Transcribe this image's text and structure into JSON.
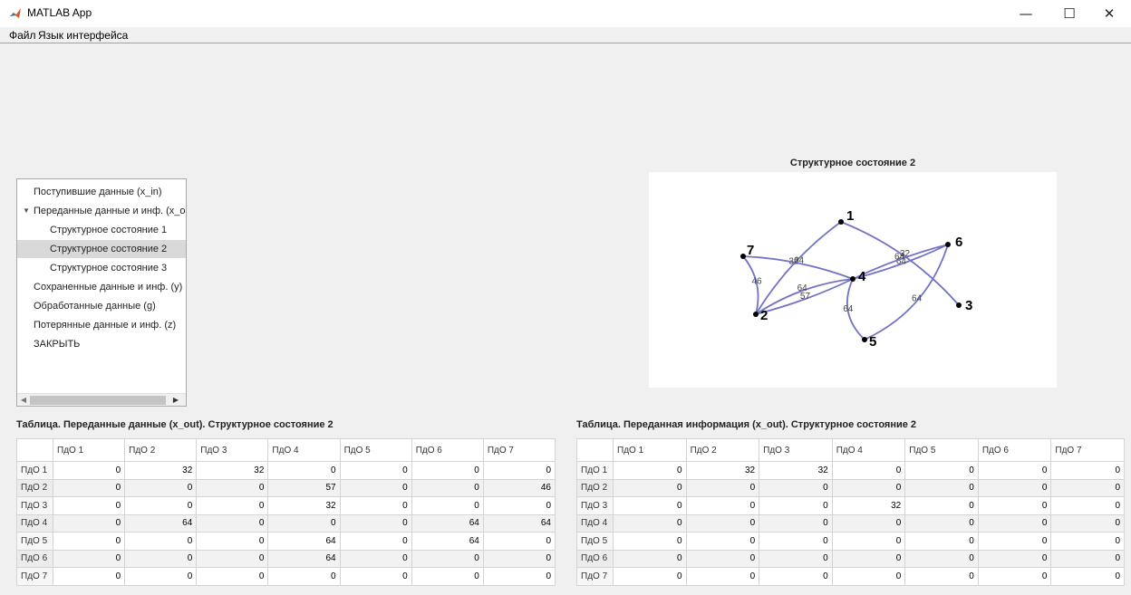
{
  "window": {
    "title": "MATLAB App",
    "min_glyph": "—",
    "max_glyph": "☐",
    "close_glyph": "✕"
  },
  "menu": [
    "Файл",
    "Язык интерфейса"
  ],
  "tree": {
    "items": [
      {
        "label": "Поступившие данные (x_in)",
        "level": 0,
        "expanded": false,
        "selected": false
      },
      {
        "label": "Переданные данные и инф. (x_out)",
        "level": 0,
        "expanded": true,
        "selected": false
      },
      {
        "label": "Структурное состояние 1",
        "level": 1,
        "expanded": false,
        "selected": false
      },
      {
        "label": "Структурное состояние 2",
        "level": 1,
        "expanded": false,
        "selected": true
      },
      {
        "label": "Структурное состояние 3",
        "level": 1,
        "expanded": false,
        "selected": false
      },
      {
        "label": "Сохраненные данные и инф. (y)",
        "level": 0,
        "expanded": false,
        "selected": false
      },
      {
        "label": "Обработанные данные (g)",
        "level": 0,
        "expanded": false,
        "selected": false
      },
      {
        "label": "Потерянные данные и инф. (z)",
        "level": 0,
        "expanded": false,
        "selected": false
      },
      {
        "label": "ЗАКРЫТЬ",
        "level": 0,
        "expanded": false,
        "selected": false
      }
    ]
  },
  "graph": {
    "title": "Структурное состояние 2",
    "edge_color": "#7272c6",
    "nodes": [
      "1",
      "2",
      "3",
      "4",
      "5",
      "6",
      "7"
    ],
    "edges": [
      {
        "from": "1",
        "to": "2",
        "label": "32"
      },
      {
        "from": "1",
        "to": "3",
        "label": "32"
      },
      {
        "from": "2",
        "to": "4",
        "label": "57"
      },
      {
        "from": "2",
        "to": "7",
        "label": "46"
      },
      {
        "from": "4",
        "to": "2",
        "label": "64"
      },
      {
        "from": "4",
        "to": "6",
        "label": "64"
      },
      {
        "from": "4",
        "to": "7",
        "label": "64"
      },
      {
        "from": "5",
        "to": "4",
        "label": "64"
      },
      {
        "from": "5",
        "to": "6",
        "label": "64"
      },
      {
        "from": "6",
        "to": "4",
        "label": "64"
      }
    ]
  },
  "table_left": {
    "caption": "Таблица. Переданные данные (x_out). Структурное состояние 2",
    "columns": [
      "ПдО 1",
      "ПдО 2",
      "ПдО 3",
      "ПдО 4",
      "ПдО 5",
      "ПдО 6",
      "ПдО 7"
    ],
    "rows": [
      {
        "label": "ПдО 1",
        "values": [
          "0",
          "32",
          "32",
          "0",
          "0",
          "0",
          "0"
        ]
      },
      {
        "label": "ПдО 2",
        "values": [
          "0",
          "0",
          "0",
          "57",
          "0",
          "0",
          "46"
        ]
      },
      {
        "label": "ПдО 3",
        "values": [
          "0",
          "0",
          "0",
          "32",
          "0",
          "0",
          "0"
        ]
      },
      {
        "label": "ПдО 4",
        "values": [
          "0",
          "64",
          "0",
          "0",
          "0",
          "64",
          "64"
        ]
      },
      {
        "label": "ПдО 5",
        "values": [
          "0",
          "0",
          "0",
          "64",
          "0",
          "64",
          "0"
        ]
      },
      {
        "label": "ПдО 6",
        "values": [
          "0",
          "0",
          "0",
          "64",
          "0",
          "0",
          "0"
        ]
      },
      {
        "label": "ПдО 7",
        "values": [
          "0",
          "0",
          "0",
          "0",
          "0",
          "0",
          "0"
        ]
      }
    ]
  },
  "table_right": {
    "caption": "Таблица. Переданная информация (x_out). Структурное состояние 2",
    "columns": [
      "ПдО 1",
      "ПдО 2",
      "ПдО 3",
      "ПдО 4",
      "ПдО 5",
      "ПдО 6",
      "ПдО 7"
    ],
    "rows": [
      {
        "label": "ПдО 1",
        "values": [
          "0",
          "32",
          "32",
          "0",
          "0",
          "0",
          "0"
        ]
      },
      {
        "label": "ПдО 2",
        "values": [
          "0",
          "0",
          "0",
          "0",
          "0",
          "0",
          "0"
        ]
      },
      {
        "label": "ПдО 3",
        "values": [
          "0",
          "0",
          "0",
          "32",
          "0",
          "0",
          "0"
        ]
      },
      {
        "label": "ПдО 4",
        "values": [
          "0",
          "0",
          "0",
          "0",
          "0",
          "0",
          "0"
        ]
      },
      {
        "label": "ПдО 5",
        "values": [
          "0",
          "0",
          "0",
          "0",
          "0",
          "0",
          "0"
        ]
      },
      {
        "label": "ПдО 6",
        "values": [
          "0",
          "0",
          "0",
          "0",
          "0",
          "0",
          "0"
        ]
      },
      {
        "label": "ПдО 7",
        "values": [
          "0",
          "0",
          "0",
          "0",
          "0",
          "0",
          "0"
        ]
      }
    ]
  }
}
